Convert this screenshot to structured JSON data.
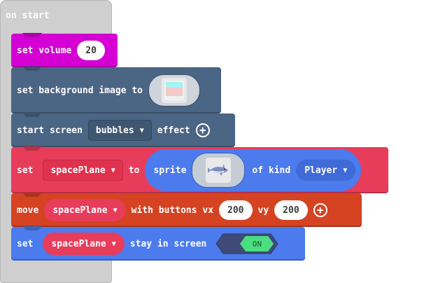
{
  "hat": {
    "label": "on start"
  },
  "volume": {
    "label": "set volume",
    "value": "20",
    "color": "#d400d4"
  },
  "background": {
    "label": "set background image to",
    "color": "#4b6584"
  },
  "screen_effect": {
    "label_start": "start screen",
    "effect": "bubbles",
    "label_end": "effect",
    "color": "#4b6584"
  },
  "set_sprite": {
    "label_set": "set",
    "variable": "spacePlane",
    "label_to": "to",
    "label_sprite": "sprite",
    "label_kind": "of kind",
    "kind": "Player",
    "color_outer": "#e83c5b",
    "color_inner": "#4b7bec"
  },
  "move": {
    "label": "move",
    "variable": "spacePlane",
    "label_buttons": "with buttons vx",
    "vx": "200",
    "label_vy": "vy",
    "vy": "200",
    "color": "#d54322"
  },
  "stay": {
    "label_set": "set",
    "variable": "spacePlane",
    "label_stay": "stay in screen",
    "toggle": "ON",
    "color": "#4b7bec"
  }
}
